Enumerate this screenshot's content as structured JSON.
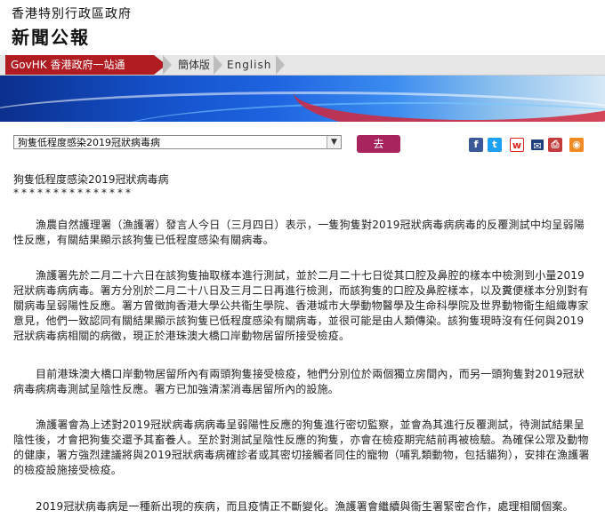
{
  "header": {
    "gov_name": "香港特別行政區政府",
    "news_title": "新聞公報"
  },
  "nav": {
    "govhk": "GovHK 香港政府一站通",
    "simplified": "簡体版",
    "english": "English"
  },
  "toolbar": {
    "select_value": "狗隻低程度感染2019冠狀病毒病",
    "go_label": "去",
    "share_icons": [
      "facebook-icon",
      "twitter-icon",
      "weibo-icon",
      "email-icon",
      "print-icon",
      "rss-icon"
    ]
  },
  "article": {
    "title": "狗隻低程度感染2019冠狀病毒病",
    "stars": "***************",
    "paragraphs": [
      "漁農自然護理署（漁護署）發言人今日（三月四日）表示，一隻狗隻對2019冠狀病毒病病毒的反覆測試中均呈弱陽性反應，有關結果顯示該狗隻已低程度感染有關病毒。",
      "漁護署先於二月二十六日在該狗隻抽取樣本進行測試，並於二月二十七日從其口腔及鼻腔的樣本中檢測到小量2019冠狀病毒病病毒。署方分別於二月二十八日及三月二日再進行檢測，而該狗隻的口腔及鼻腔樣本，以及糞便樣本分別對有關病毒呈弱陽性反應。署方曾徵詢香港大學公共衞生學院、香港城市大學動物醫學及生命科學院及世界動物衞生組織專家意見，他們一致認同有關結果顯示該狗隻已低程度感染有關病毒，並很可能是由人類傳染。該狗隻現時沒有任何與2019冠狀病毒病相關的病徵，現正於港珠澳大橋口岸動物居留所接受檢疫。",
      "目前港珠澳大橋口岸動物居留所內有兩頭狗隻接受檢疫，牠們分別位於兩個獨立房間內，而另一頭狗隻對2019冠狀病毒病病毒測試呈陰性反應。署方已加強清潔消毒居留所內的設施。",
      "漁護署會為上述對2019冠狀病毒病病毒呈弱陽性反應的狗隻進行密切監察，並會為其進行反覆測試，待測試結果呈陰性後，才會把狗隻交還予其畜養人。至於對測試呈陰性反應的狗隻，亦會在檢疫期完結前再被檢驗。為確保公眾及動物的健康，署方強烈建議將與2019冠狀病毒病確診者或其密切接觸者同住的寵物（哺乳類動物，包括貓狗），安排在漁護署的檢疫設施接受檢疫。",
      "2019冠狀病毒病是一種新出現的疾病，而且疫情正不斷變化。漁護署會繼續與衞生署緊密合作，處理相關個案。"
    ]
  },
  "colors": {
    "accent_red": "#b01c22",
    "go_button": "#a8245e"
  }
}
